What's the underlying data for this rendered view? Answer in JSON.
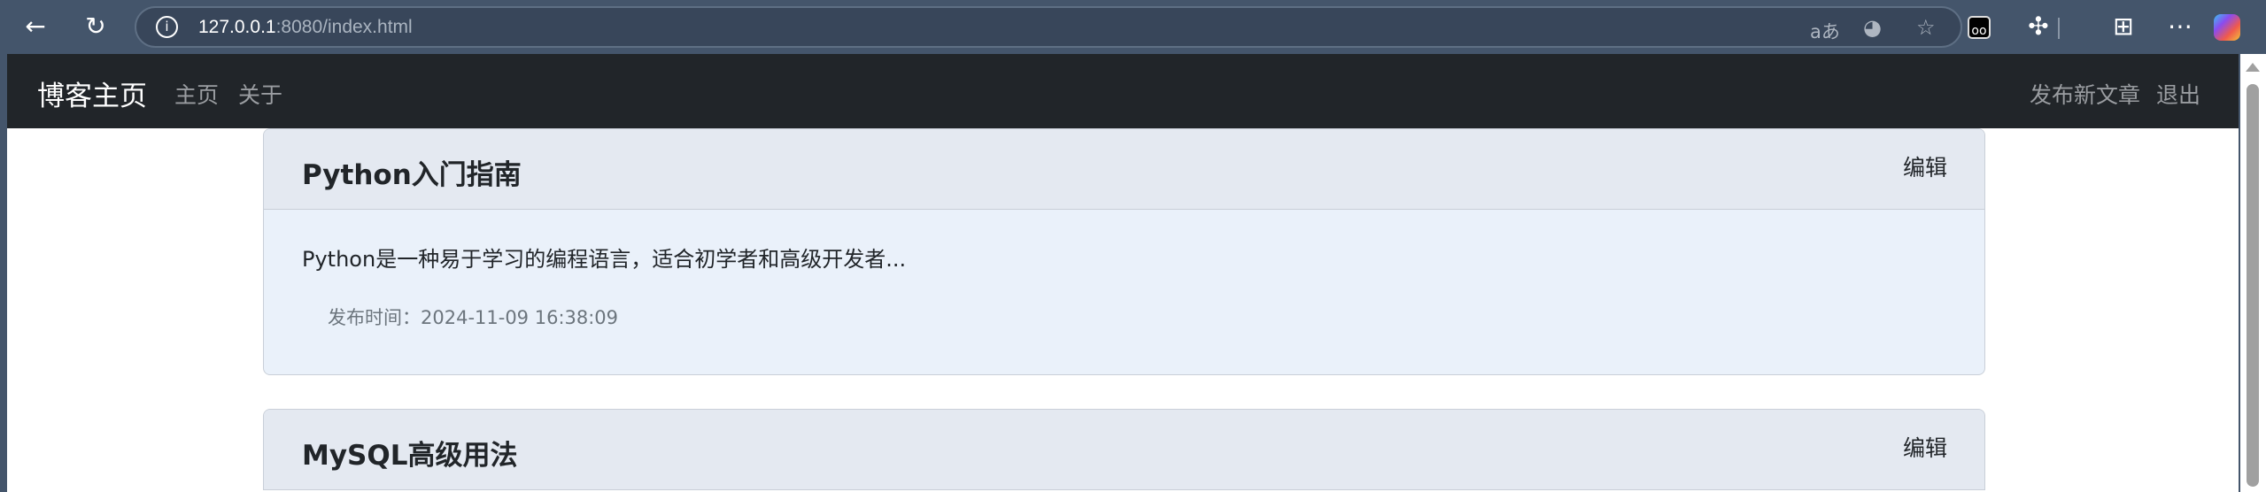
{
  "browser": {
    "url_host": "127.0.0.1",
    "url_rest": ":8080/index.html"
  },
  "nav": {
    "brand": "博客主页",
    "links": [
      "主页",
      "关于"
    ],
    "right_links": [
      "发布新文章",
      "退出"
    ]
  },
  "posts": [
    {
      "title": "Python入门指南",
      "edit_label": "编辑",
      "summary": "Python是一种易于学习的编程语言，适合初学者和高级开发者...",
      "time_label": "发布时间：",
      "time": "2024-11-09 16:38:09"
    },
    {
      "title": "MySQL高级用法",
      "edit_label": "编辑"
    }
  ],
  "colors": {
    "navbar": "#212529",
    "card_header": "#e4e9f1",
    "card_body": "#eaf1fa",
    "browser_chrome": "#44556b"
  }
}
